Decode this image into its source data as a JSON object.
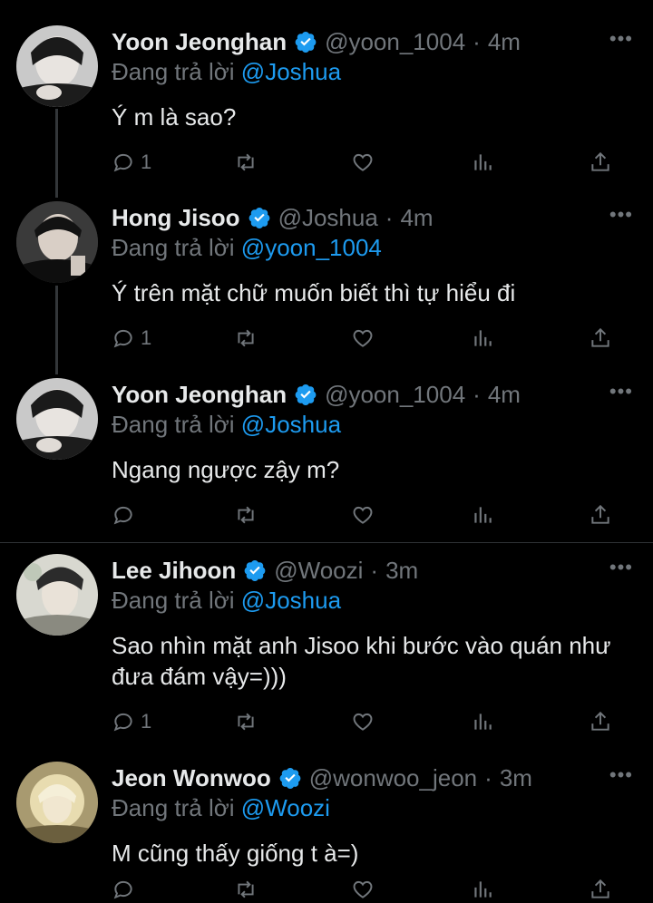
{
  "reply_prefix": "Đang trả lời",
  "more_label": "•••",
  "colors": {
    "background": "#000000",
    "text": "#e7e9ea",
    "muted": "#71767b",
    "accent": "#1d9bf0"
  },
  "tweets": [
    {
      "name": "Yoon Jeonghan",
      "handle": "@yoon_1004",
      "sep": "·",
      "time": "4m",
      "reply_to": "@Joshua",
      "text": "Ý m là sao?",
      "reply_count": "1",
      "avatar": "avatar-jeonghan"
    },
    {
      "name": "Hong Jisoo",
      "handle": "@Joshua",
      "sep": "·",
      "time": "4m",
      "reply_to": "@yoon_1004",
      "text": "Ý trên mặt chữ muốn biết thì tự hiểu đi",
      "reply_count": "1",
      "avatar": "avatar-jisoo"
    },
    {
      "name": "Yoon Jeonghan",
      "handle": "@yoon_1004",
      "sep": "·",
      "time": "4m",
      "reply_to": "@Joshua",
      "text": "Ngang ngược zậy m?",
      "reply_count": "",
      "avatar": "avatar-jeonghan"
    },
    {
      "name": "Lee Jihoon",
      "handle": "@Woozi",
      "sep": "·",
      "time": "3m",
      "reply_to": "@Joshua",
      "text": "Sao nhìn mặt anh Jisoo khi bước vào quán như đưa đám vậy=)))",
      "reply_count": "1",
      "avatar": "avatar-jihoon"
    },
    {
      "name": "Jeon Wonwoo",
      "handle": "@wonwoo_jeon",
      "sep": "·",
      "time": "3m",
      "reply_to": "@Woozi",
      "text": "M cũng thấy giống t à=)",
      "reply_count": "",
      "avatar": "avatar-wonwoo"
    }
  ]
}
